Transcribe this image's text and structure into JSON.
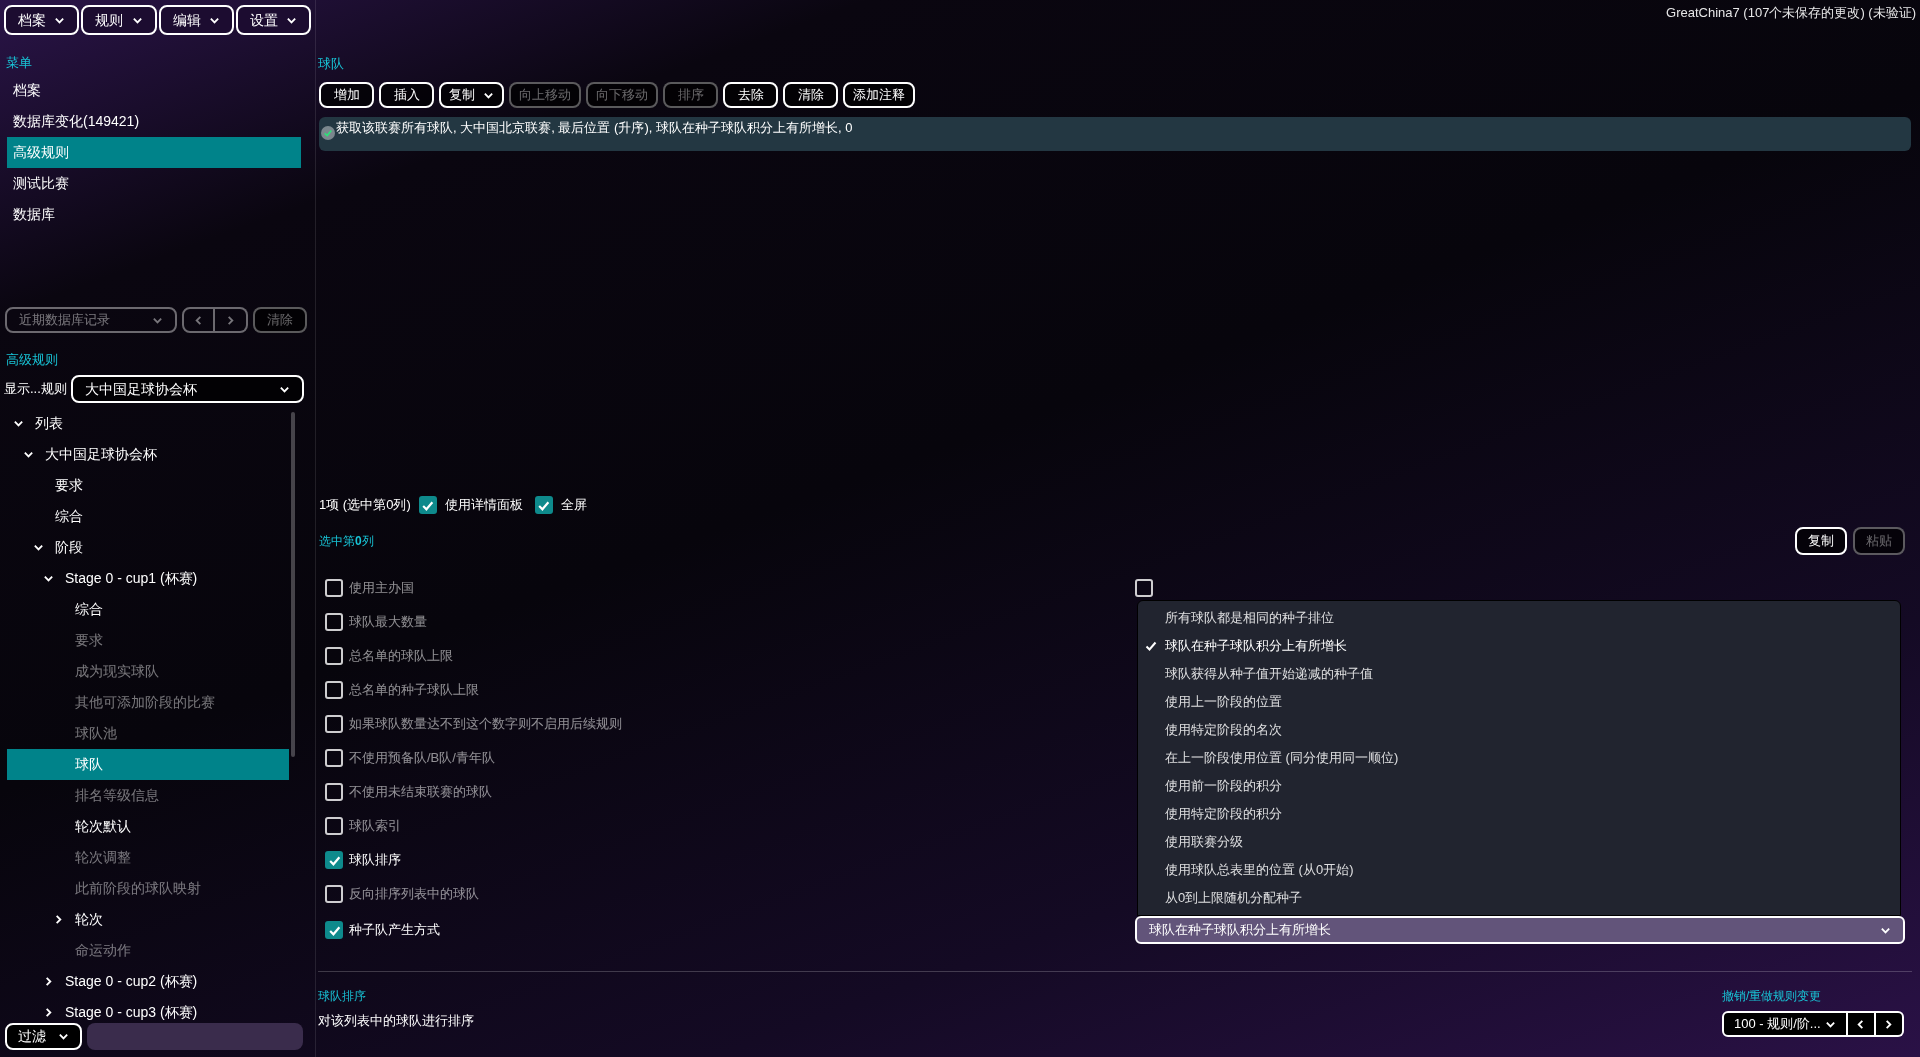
{
  "menu_bar": [
    {
      "label": "档案"
    },
    {
      "label": "规则"
    },
    {
      "label": "编辑"
    },
    {
      "label": "设置"
    }
  ],
  "title": "GreatChina7 (107个未保存的更改) (未验证)",
  "sidebar": {
    "heading": "菜单",
    "items": [
      {
        "label": "档案",
        "selected": false
      },
      {
        "label": "数据库变化(149421)",
        "selected": false
      },
      {
        "label": "高级规则",
        "selected": true
      },
      {
        "label": "测试比赛",
        "selected": false
      },
      {
        "label": "数据库",
        "selected": false
      }
    ],
    "recent": {
      "label": "近期数据库记录",
      "disabled": true,
      "clear": "清除"
    },
    "rules_heading": "高级规则",
    "show_label": "显示...规则",
    "show_value": "大中国足球协会杯",
    "tree": [
      {
        "label": "列表",
        "expanded": true,
        "dimmed": false,
        "selected": false,
        "children": [
          {
            "label": "大中国足球协会杯",
            "expanded": true,
            "dimmed": false,
            "selected": false,
            "children": [
              {
                "label": "要求",
                "dimmed": false,
                "selected": false
              },
              {
                "label": "综合",
                "dimmed": false,
                "selected": false
              },
              {
                "label": "阶段",
                "expanded": true,
                "dimmed": false,
                "selected": false,
                "children": [
                  {
                    "label": "Stage 0 - cup1 (杯赛)",
                    "expanded": true,
                    "dimmed": false,
                    "selected": false,
                    "children": [
                      {
                        "label": "综合",
                        "dimmed": false,
                        "selected": false
                      },
                      {
                        "label": "要求",
                        "dimmed": true,
                        "selected": false
                      },
                      {
                        "label": "成为现实球队",
                        "dimmed": true,
                        "selected": false
                      },
                      {
                        "label": "其他可添加阶段的比赛",
                        "dimmed": true,
                        "selected": false
                      },
                      {
                        "label": "球队池",
                        "dimmed": true,
                        "selected": false
                      },
                      {
                        "label": "球队",
                        "dimmed": false,
                        "selected": true
                      },
                      {
                        "label": "排名等级信息",
                        "dimmed": true,
                        "selected": false
                      },
                      {
                        "label": "轮次默认",
                        "dimmed": false,
                        "selected": false
                      },
                      {
                        "label": "轮次调整",
                        "dimmed": true,
                        "selected": false
                      },
                      {
                        "label": "此前阶段的球队映射",
                        "dimmed": true,
                        "selected": false
                      },
                      {
                        "label": "轮次",
                        "expanded": false,
                        "dimmed": false,
                        "selected": false
                      },
                      {
                        "label": "命运动作",
                        "dimmed": true,
                        "selected": false
                      }
                    ]
                  },
                  {
                    "label": "Stage 0 - cup2 (杯赛)",
                    "expanded": false,
                    "dimmed": false,
                    "selected": false
                  },
                  {
                    "label": "Stage 0 - cup3 (杯赛)",
                    "expanded": false,
                    "dimmed": false,
                    "selected": false
                  }
                ]
              }
            ]
          }
        ]
      }
    ],
    "filter": {
      "label": "过滤"
    }
  },
  "main": {
    "heading": "球队",
    "toolbar": [
      {
        "label": "增加",
        "disabled": false,
        "dropdown": false
      },
      {
        "label": "插入",
        "disabled": false,
        "dropdown": false
      },
      {
        "label": "复制",
        "disabled": false,
        "dropdown": true
      },
      {
        "label": "向上移动",
        "disabled": true,
        "dropdown": false
      },
      {
        "label": "向下移动",
        "disabled": true,
        "dropdown": false
      },
      {
        "label": "排序",
        "disabled": true,
        "dropdown": false
      },
      {
        "label": "去除",
        "disabled": false,
        "dropdown": false
      },
      {
        "label": "清除",
        "disabled": false,
        "dropdown": false
      },
      {
        "label": "添加注释",
        "disabled": false,
        "dropdown": false
      }
    ],
    "entries": [
      {
        "text": "获取该联赛所有球队, 大中国北京联赛, 最后位置 (升序), 球队在种子球队积分上有所增长, 0",
        "valid": true
      }
    ],
    "summary": "1项 (选中第0列)",
    "options": [
      {
        "label": "使用详情面板",
        "checked": true
      },
      {
        "label": "全屏",
        "checked": true
      }
    ],
    "selection_heading": "选中第**0**列",
    "actions": [
      {
        "label": "复制",
        "disabled": false
      },
      {
        "label": "粘贴",
        "disabled": true
      }
    ],
    "fields": [
      {
        "label": "使用主办国",
        "checked": false,
        "control": {
          "kind": "checkbox",
          "checked": false
        }
      },
      {
        "label": "球队最大数量",
        "checked": false
      },
      {
        "label": "总名单的球队上限",
        "checked": false
      },
      {
        "label": "总名单的种子球队上限",
        "checked": false
      },
      {
        "label": "如果球队数量达不到这个数字则不启用后续规则",
        "checked": false
      },
      {
        "label": "不使用预备队/B队/青年队",
        "checked": false
      },
      {
        "label": "不使用未结束联赛的球队",
        "checked": false
      },
      {
        "label": "球队索引",
        "checked": false
      },
      {
        "label": "球队排序",
        "checked": true
      },
      {
        "label": "反向排序列表中的球队",
        "checked": false
      },
      {
        "label": "种子队产生方式",
        "checked": true,
        "control": {
          "kind": "select",
          "value": "球队在种子球队积分上有所增长",
          "open": true,
          "options": [
            {
              "label": "所有球队都是相同的种子排位",
              "selected": false
            },
            {
              "label": "球队在种子球队积分上有所增长",
              "selected": true
            },
            {
              "label": "球队获得从种子值开始递减的种子值",
              "selected": false
            },
            {
              "label": "使用上一阶段的位置",
              "selected": false
            },
            {
              "label": "使用特定阶段的名次",
              "selected": false
            },
            {
              "label": "在上一阶段使用位置 (同分使用同一顺位)",
              "selected": false
            },
            {
              "label": "使用前一阶段的积分",
              "selected": false
            },
            {
              "label": "使用特定阶段的积分",
              "selected": false
            },
            {
              "label": "使用联赛分级",
              "selected": false
            },
            {
              "label": "使用球队总表里的位置 (从0开始)",
              "selected": false
            },
            {
              "label": "从0到上限随机分配种子",
              "selected": false
            }
          ]
        }
      }
    ],
    "help": {
      "title": "球队排序",
      "text": "对该列表中的球队进行排序"
    },
    "undo": {
      "heading": "撤销/重做规则变更",
      "value": "100 - 规则/阶..."
    }
  }
}
